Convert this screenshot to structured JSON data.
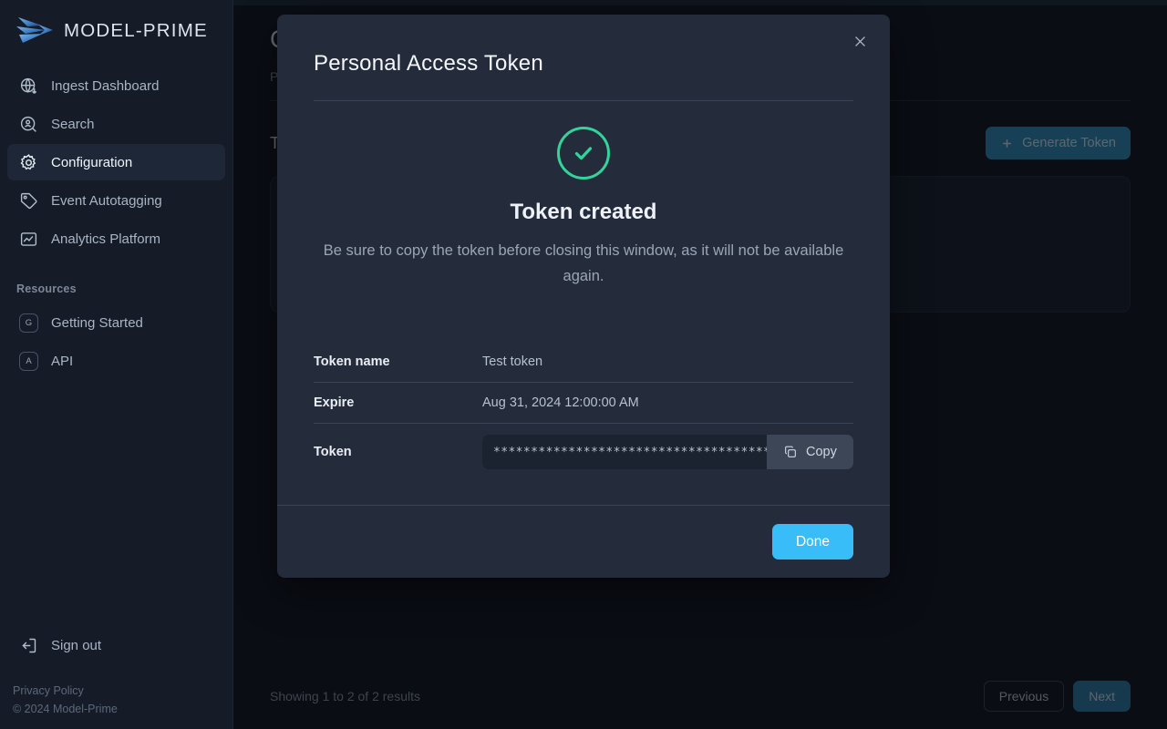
{
  "brand": {
    "name": "MODEL-PRIME",
    "logo_icon": "model-prime-wing-logo"
  },
  "sidebar": {
    "items": [
      {
        "label": "Ingest Dashboard",
        "icon": "globe-download-icon",
        "active": false
      },
      {
        "label": "Search",
        "icon": "magnifier-person-icon",
        "active": false
      },
      {
        "label": "Configuration",
        "icon": "gear-icon",
        "active": true
      },
      {
        "label": "Event Autotagging",
        "icon": "tag-icon",
        "active": false
      },
      {
        "label": "Analytics Platform",
        "icon": "chart-image-icon",
        "active": false
      }
    ],
    "resources_label": "Resources",
    "resources": [
      {
        "label": "Getting Started",
        "badge": "G"
      },
      {
        "label": "API",
        "badge": "A"
      }
    ],
    "signout": {
      "label": "Sign out",
      "icon": "sign-out-icon"
    },
    "legal": {
      "privacy": "Privacy Policy",
      "copyright": "© 2024 Model-Prime"
    }
  },
  "main": {
    "page_title": "Configuration",
    "page_subtitle": "Personal access tokens",
    "section_title": "Tokens",
    "generate_button": {
      "label": "Generate Token",
      "icon": "plus-icon"
    },
    "results_text": "Showing 1 to 2 of 2 results",
    "pagination": {
      "previous": "Previous",
      "next": "Next"
    }
  },
  "modal": {
    "title": "Personal Access Token",
    "close_icon": "close-icon",
    "status_icon": "check-circle-icon",
    "status_heading": "Token created",
    "status_description": "Be sure to copy the token before closing this window, as it will not be available again.",
    "details": [
      {
        "key": "Token name",
        "value": "Test token"
      },
      {
        "key": "Expire",
        "value": "Aug 31, 2024 12:00:00 AM"
      }
    ],
    "token_row": {
      "key": "Token",
      "masked_value": "********************************************",
      "copy_label": "Copy",
      "copy_icon": "copy-icon"
    },
    "done_label": "Done"
  },
  "colors": {
    "accent_blue": "#38bdf8",
    "success_green": "#34d399",
    "generate_blue": "#2e8fc0",
    "modal_bg": "#242c3c",
    "app_bg": "#0d1119",
    "sidebar_bg": "#151c28"
  }
}
